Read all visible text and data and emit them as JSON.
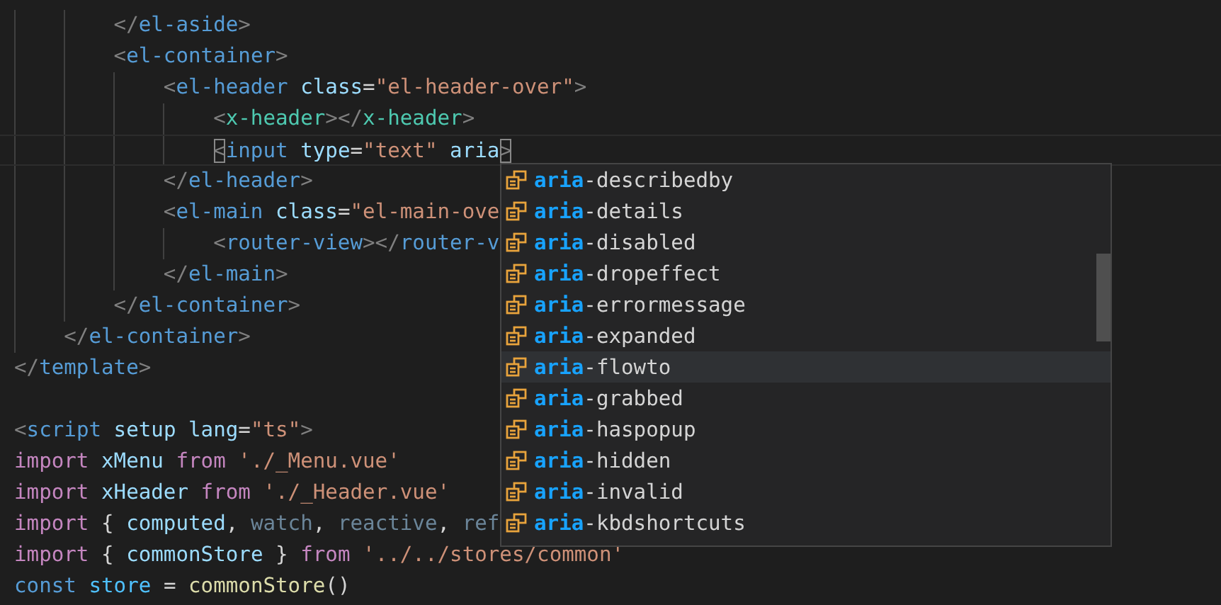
{
  "editor": {
    "template_lines": [
      {
        "current": false,
        "tokens": [
          {
            "t": "        </",
            "kind": "punct"
          },
          {
            "t": "el-aside",
            "kind": "tag"
          },
          {
            "t": ">",
            "kind": "punct"
          }
        ]
      },
      {
        "current": false,
        "tokens": [
          {
            "t": "        <",
            "kind": "punct"
          },
          {
            "t": "el-container",
            "kind": "tag"
          },
          {
            "t": ">",
            "kind": "punct"
          }
        ]
      },
      {
        "current": false,
        "tokens": [
          {
            "t": "            <",
            "kind": "punct"
          },
          {
            "t": "el-header",
            "kind": "tag"
          },
          {
            "t": " class",
            "kind": "attr"
          },
          {
            "t": "=",
            "kind": "plain"
          },
          {
            "t": "\"el-header-over\"",
            "kind": "string"
          },
          {
            "t": ">",
            "kind": "punct"
          }
        ]
      },
      {
        "current": false,
        "tokens": [
          {
            "t": "                <",
            "kind": "punct"
          },
          {
            "t": "x-header",
            "kind": "component"
          },
          {
            "t": "></",
            "kind": "punct"
          },
          {
            "t": "x-header",
            "kind": "component"
          },
          {
            "t": ">",
            "kind": "punct"
          }
        ]
      },
      {
        "current": true,
        "tokens": [
          {
            "t": "                <",
            "kind": "matched_bracket"
          },
          {
            "t": "input",
            "kind": "tag"
          },
          {
            "t": " type",
            "kind": "attr"
          },
          {
            "t": "=",
            "kind": "plain"
          },
          {
            "t": "\"text\"",
            "kind": "string"
          },
          {
            "t": " aria",
            "kind": "attr"
          },
          {
            "t": ">",
            "kind": "matched_bracket"
          }
        ]
      },
      {
        "current": false,
        "tokens": [
          {
            "t": "            </",
            "kind": "punct"
          },
          {
            "t": "el-header",
            "kind": "tag"
          },
          {
            "t": ">",
            "kind": "punct"
          }
        ]
      },
      {
        "current": false,
        "tokens": [
          {
            "t": "            <",
            "kind": "punct"
          },
          {
            "t": "el-main",
            "kind": "tag"
          },
          {
            "t": " class",
            "kind": "attr"
          },
          {
            "t": "=",
            "kind": "plain"
          },
          {
            "t": "\"el-main-ove",
            "kind": "string"
          }
        ]
      },
      {
        "current": false,
        "tokens": [
          {
            "t": "                <",
            "kind": "punct"
          },
          {
            "t": "router-view",
            "kind": "tag"
          },
          {
            "t": "></",
            "kind": "punct"
          },
          {
            "t": "router-v",
            "kind": "tag"
          }
        ]
      },
      {
        "current": false,
        "tokens": [
          {
            "t": "            </",
            "kind": "punct"
          },
          {
            "t": "el-main",
            "kind": "tag"
          },
          {
            "t": ">",
            "kind": "punct"
          }
        ]
      },
      {
        "current": false,
        "tokens": [
          {
            "t": "        </",
            "kind": "punct"
          },
          {
            "t": "el-container",
            "kind": "tag"
          },
          {
            "t": ">",
            "kind": "punct"
          }
        ]
      },
      {
        "current": false,
        "tokens": [
          {
            "t": "    </",
            "kind": "punct"
          },
          {
            "t": "el-container",
            "kind": "tag"
          },
          {
            "t": ">",
            "kind": "punct"
          }
        ]
      },
      {
        "current": false,
        "tokens": [
          {
            "t": "</",
            "kind": "punct"
          },
          {
            "t": "template",
            "kind": "tag"
          },
          {
            "t": ">",
            "kind": "punct"
          }
        ]
      }
    ],
    "script_lines": [
      {
        "current": false,
        "tokens": [
          {
            "t": "<",
            "kind": "punct"
          },
          {
            "t": "script",
            "kind": "tag"
          },
          {
            "t": " setup",
            "kind": "attr"
          },
          {
            "t": " lang",
            "kind": "attr"
          },
          {
            "t": "=",
            "kind": "plain"
          },
          {
            "t": "\"ts\"",
            "kind": "string"
          },
          {
            "t": ">",
            "kind": "punct"
          }
        ]
      },
      {
        "current": false,
        "tokens": [
          {
            "t": "import",
            "kind": "control"
          },
          {
            "t": " xMenu",
            "kind": "variable"
          },
          {
            "t": " from",
            "kind": "control"
          },
          {
            "t": " './_Menu.vue'",
            "kind": "string"
          }
        ]
      },
      {
        "current": false,
        "tokens": [
          {
            "t": "import",
            "kind": "control"
          },
          {
            "t": " xHeader",
            "kind": "variable"
          },
          {
            "t": " from",
            "kind": "control"
          },
          {
            "t": " './_Header.vue'",
            "kind": "string"
          }
        ]
      },
      {
        "current": false,
        "tokens": [
          {
            "t": "import",
            "kind": "control"
          },
          {
            "t": " { ",
            "kind": "plain"
          },
          {
            "t": "computed",
            "kind": "variable"
          },
          {
            "t": ", ",
            "kind": "plain"
          },
          {
            "t": "watch",
            "kind": "unused"
          },
          {
            "t": ", ",
            "kind": "plain"
          },
          {
            "t": "reactive",
            "kind": "unused"
          },
          {
            "t": ", ",
            "kind": "plain"
          },
          {
            "t": "ref",
            "kind": "unused"
          }
        ]
      },
      {
        "current": false,
        "tokens": [
          {
            "t": "import",
            "kind": "control"
          },
          {
            "t": " { ",
            "kind": "plain"
          },
          {
            "t": "commonStore",
            "kind": "variable"
          },
          {
            "t": " } ",
            "kind": "plain"
          },
          {
            "t": "from",
            "kind": "control"
          },
          {
            "t": " '../../stores/common'",
            "kind": "string"
          }
        ]
      },
      {
        "current": false,
        "tokens": [
          {
            "t": "const",
            "kind": "keyword"
          },
          {
            "t": " store",
            "kind": "constant"
          },
          {
            "t": " = ",
            "kind": "plain"
          },
          {
            "t": "commonStore",
            "kind": "function"
          },
          {
            "t": "()",
            "kind": "plain"
          }
        ]
      }
    ]
  },
  "suggestions": [
    {
      "match": "aria",
      "rest": "-describedby",
      "selected": false
    },
    {
      "match": "aria",
      "rest": "-details",
      "selected": false
    },
    {
      "match": "aria",
      "rest": "-disabled",
      "selected": false
    },
    {
      "match": "aria",
      "rest": "-dropeffect",
      "selected": false
    },
    {
      "match": "aria",
      "rest": "-errormessage",
      "selected": false
    },
    {
      "match": "aria",
      "rest": "-expanded",
      "selected": false
    },
    {
      "match": "aria",
      "rest": "-flowto",
      "selected": true
    },
    {
      "match": "aria",
      "rest": "-grabbed",
      "selected": false
    },
    {
      "match": "aria",
      "rest": "-haspopup",
      "selected": false
    },
    {
      "match": "aria",
      "rest": "-hidden",
      "selected": false
    },
    {
      "match": "aria",
      "rest": "-invalid",
      "selected": false
    },
    {
      "match": "aria",
      "rest": "-kbdshortcuts",
      "selected": false
    }
  ]
}
